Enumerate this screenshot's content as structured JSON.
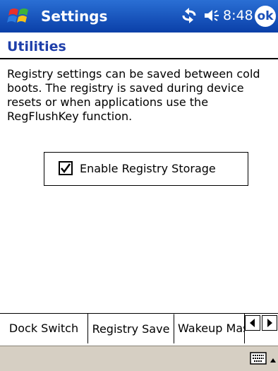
{
  "titlebar": {
    "app_title": "Settings",
    "time": "8:48",
    "ok_label": "ok",
    "icons": [
      "windows-start-icon",
      "connectivity-icon",
      "volume-icon"
    ]
  },
  "page": {
    "title": "Utilities",
    "description": "Registry settings can be saved between cold boots. The registry is saved during device resets or when applications use the RegFlushKey function."
  },
  "option": {
    "label": "Enable Registry Storage",
    "checked": true
  },
  "tabs": [
    {
      "label": "Dock Switch"
    },
    {
      "label": "Registry Save"
    },
    {
      "label": "Wakeup Mas"
    }
  ],
  "colors": {
    "titlebar": "#0a3fa8",
    "title_text": "#1f3faa",
    "menubar": "#d6cfc3"
  }
}
